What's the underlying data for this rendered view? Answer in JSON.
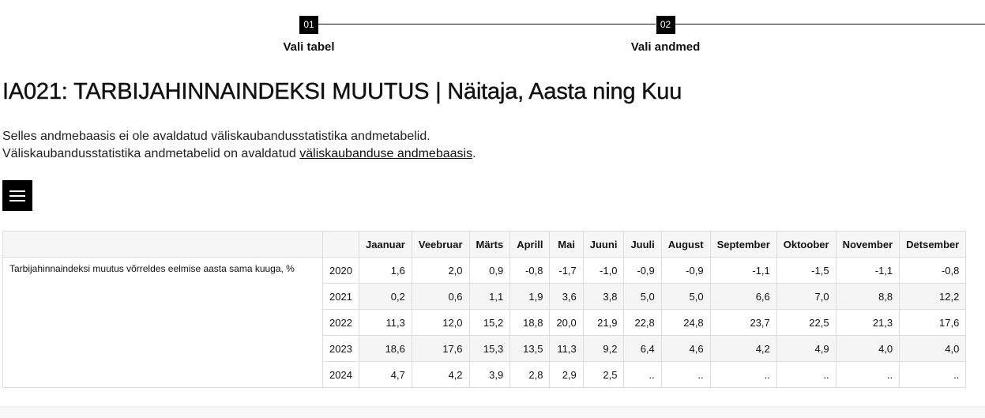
{
  "stepper": {
    "steps": [
      {
        "num": "01",
        "label": "Vali tabel"
      },
      {
        "num": "02",
        "label": "Vali andmed"
      }
    ]
  },
  "title": "IA021: TARBIJAHINNAINDEKSI MUUTUS | Näitaja, Aasta ning Kuu",
  "intro": {
    "line1": "Selles andmebaasis ei ole avaldatud väliskaubandusstatistika andmetabelid.",
    "line2_prefix": "Väliskaubandusstatistika andmetabelid on avaldatud ",
    "line2_link": "väliskaubanduse andmebaasis",
    "line2_suffix": "."
  },
  "table": {
    "months": [
      "Jaanuar",
      "Veebruar",
      "Märts",
      "Aprill",
      "Mai",
      "Juuni",
      "Juuli",
      "August",
      "September",
      "Oktoober",
      "November",
      "Detsember"
    ],
    "indicator": "Tarbijahinnaindeksi muutus võrreldes eelmise aasta sama kuuga, %",
    "rows": [
      {
        "year": "2020",
        "values": [
          "1,6",
          "2,0",
          "0,9",
          "-0,8",
          "-1,7",
          "-1,0",
          "-0,9",
          "-0,9",
          "-1,1",
          "-1,5",
          "-1,1",
          "-0,8"
        ]
      },
      {
        "year": "2021",
        "values": [
          "0,2",
          "0,6",
          "1,1",
          "1,9",
          "3,6",
          "3,8",
          "5,0",
          "5,0",
          "6,6",
          "7,0",
          "8,8",
          "12,2"
        ]
      },
      {
        "year": "2022",
        "values": [
          "11,3",
          "12,0",
          "15,2",
          "18,8",
          "20,0",
          "21,9",
          "22,8",
          "24,8",
          "23,7",
          "22,5",
          "21,3",
          "17,6"
        ]
      },
      {
        "year": "2023",
        "values": [
          "18,6",
          "17,6",
          "15,3",
          "13,5",
          "11,3",
          "9,2",
          "6,4",
          "4,6",
          "4,2",
          "4,9",
          "4,0",
          "4,0"
        ]
      },
      {
        "year": "2024",
        "values": [
          "4,7",
          "4,2",
          "3,9",
          "2,8",
          "2,9",
          "2,5",
          "..",
          "..",
          "..",
          "..",
          "..",
          ".."
        ]
      }
    ]
  }
}
